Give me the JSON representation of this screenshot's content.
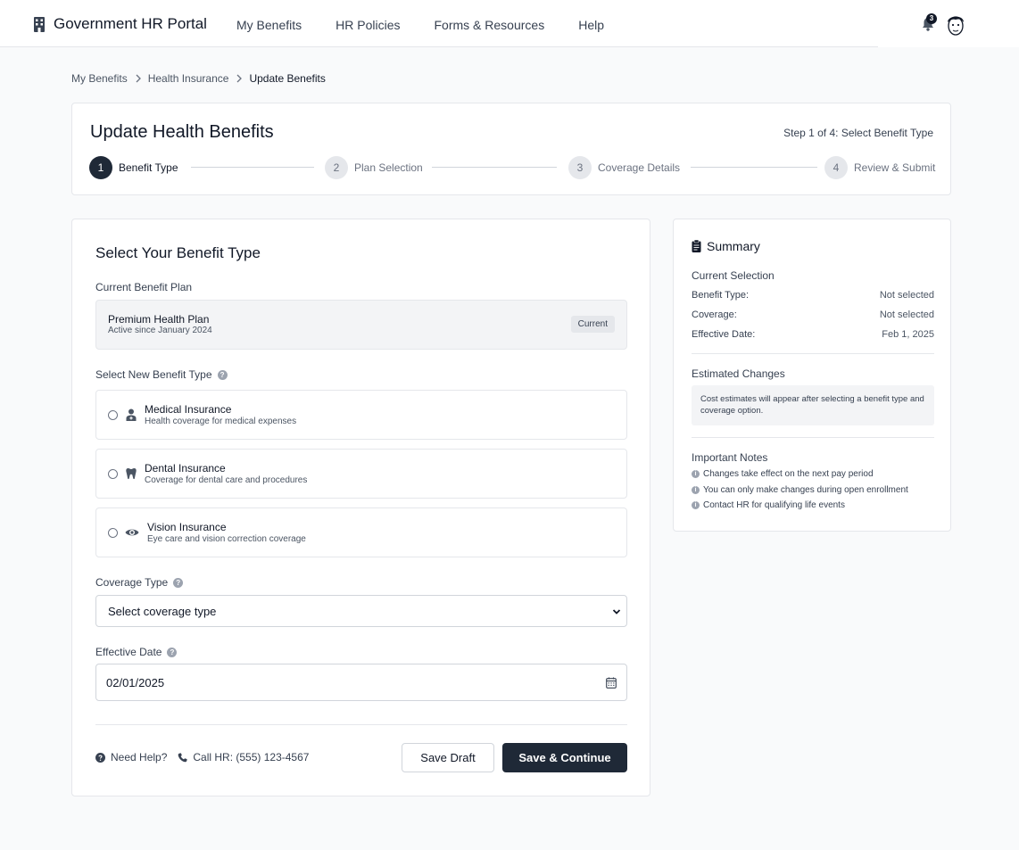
{
  "nav": {
    "brand": "Government HR Portal",
    "links": [
      "My Benefits",
      "HR Policies",
      "Forms & Resources",
      "Help"
    ],
    "notification_count": "3"
  },
  "breadcrumb": [
    "My Benefits",
    "Health Insurance",
    "Update Benefits"
  ],
  "header": {
    "title": "Update Health Benefits",
    "step_indicator": "Step 1 of 4: Select Benefit Type",
    "steps": [
      {
        "num": "1",
        "label": "Benefit Type"
      },
      {
        "num": "2",
        "label": "Plan Selection"
      },
      {
        "num": "3",
        "label": "Coverage Details"
      },
      {
        "num": "4",
        "label": "Review & Submit"
      }
    ]
  },
  "form": {
    "section_title": "Select Your Benefit Type",
    "current_plan_label": "Current Benefit Plan",
    "current_plan": {
      "name": "Premium Health Plan",
      "since": "Active since January 2024",
      "badge": "Current"
    },
    "new_type_label": "Select New Benefit Type",
    "options": [
      {
        "title": "Medical Insurance",
        "desc": "Health coverage for medical expenses",
        "icon": "user-doctor-icon"
      },
      {
        "title": "Dental Insurance",
        "desc": "Coverage for dental care and procedures",
        "icon": "tooth-icon"
      },
      {
        "title": "Vision Insurance",
        "desc": "Eye care and vision correction coverage",
        "icon": "eye-icon"
      }
    ],
    "coverage_label": "Coverage Type",
    "coverage_value": "Select coverage type",
    "date_label": "Effective Date",
    "date_value": "02/01/2025",
    "help_text": "Need Help?",
    "call_text": "Call HR: (555) 123-4567",
    "save_draft": "Save Draft",
    "save_continue": "Save & Continue"
  },
  "summary": {
    "title": "Summary",
    "current_selection": "Current Selection",
    "rows": [
      {
        "label": "Benefit Type:",
        "value": "Not selected"
      },
      {
        "label": "Coverage:",
        "value": "Not selected"
      },
      {
        "label": "Effective Date:",
        "value": "Feb 1, 2025"
      }
    ],
    "estimated_title": "Estimated Changes",
    "estimated_text": "Cost estimates will appear after selecting a benefit type and coverage option.",
    "notes_title": "Important Notes",
    "notes": [
      "Changes take effect on the next pay period",
      "You can only make changes during open enrollment",
      "Contact HR for qualifying life events"
    ]
  },
  "colors": {
    "primary": "#1f2937",
    "border": "#e5e7eb",
    "background": "#f9fafb"
  }
}
